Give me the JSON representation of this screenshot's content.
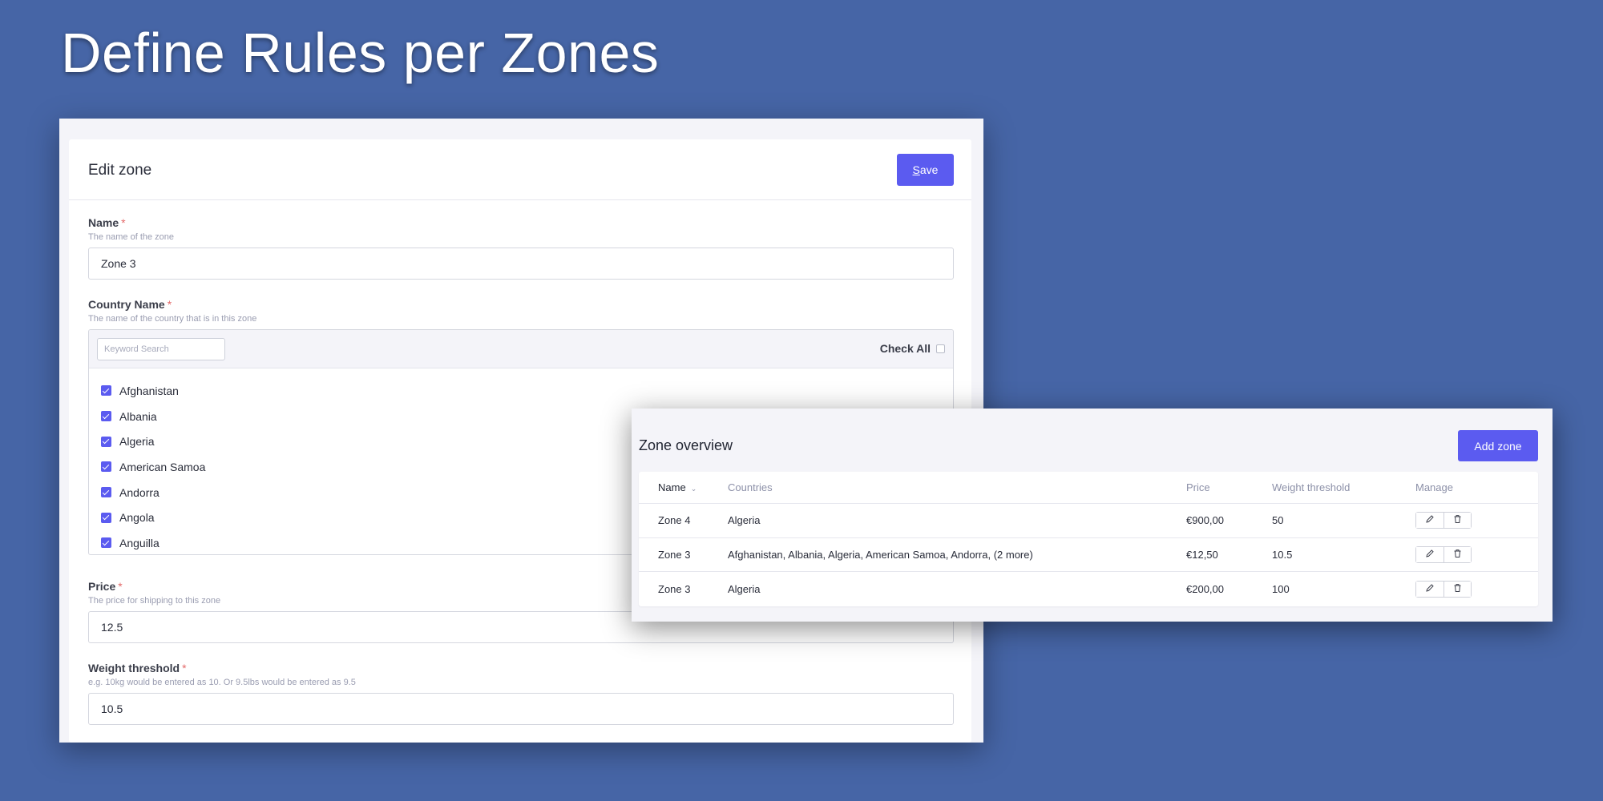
{
  "headline": "Define Rules per Zones",
  "edit_zone": {
    "title": "Edit zone",
    "save_label": "Save",
    "name_field": {
      "label": "Name",
      "required_mark": "*",
      "help": "The name of the zone",
      "value": "Zone 3"
    },
    "country_field": {
      "label": "Country Name",
      "required_mark": "*",
      "help": "The name of the country that is in this zone",
      "search_placeholder": "Keyword Search",
      "check_all_label": "Check All",
      "countries": [
        "Afghanistan",
        "Albania",
        "Algeria",
        "American Samoa",
        "Andorra",
        "Angola",
        "Anguilla"
      ]
    },
    "price_field": {
      "label": "Price",
      "required_mark": "*",
      "help": "The price for shipping to this zone",
      "value": "12.5"
    },
    "weight_field": {
      "label": "Weight threshold",
      "required_mark": "*",
      "help": "e.g. 10kg would be entered as 10. Or 9.5lbs would be entered as 9.5",
      "value": "10.5"
    }
  },
  "zone_overview": {
    "title": "Zone overview",
    "add_label": "Add zone",
    "columns": [
      "Name",
      "Countries",
      "Price",
      "Weight threshold",
      "Manage"
    ],
    "rows": [
      {
        "name": "Zone 4",
        "countries": "Algeria",
        "price": "€900,00",
        "weight": "50"
      },
      {
        "name": "Zone 3",
        "countries": "Afghanistan, Albania, Algeria, American Samoa, Andorra, (2 more)",
        "price": "€12,50",
        "weight": "10.5"
      },
      {
        "name": "Zone 3",
        "countries": "Algeria",
        "price": "€200,00",
        "weight": "100"
      }
    ]
  },
  "colors": {
    "background": "#4665a6",
    "accent": "#5b5bf0"
  },
  "icons": {
    "sort": "chevron-down-icon",
    "edit": "pencil-icon",
    "delete": "trash-icon",
    "checkbox": "checkmark-icon"
  }
}
